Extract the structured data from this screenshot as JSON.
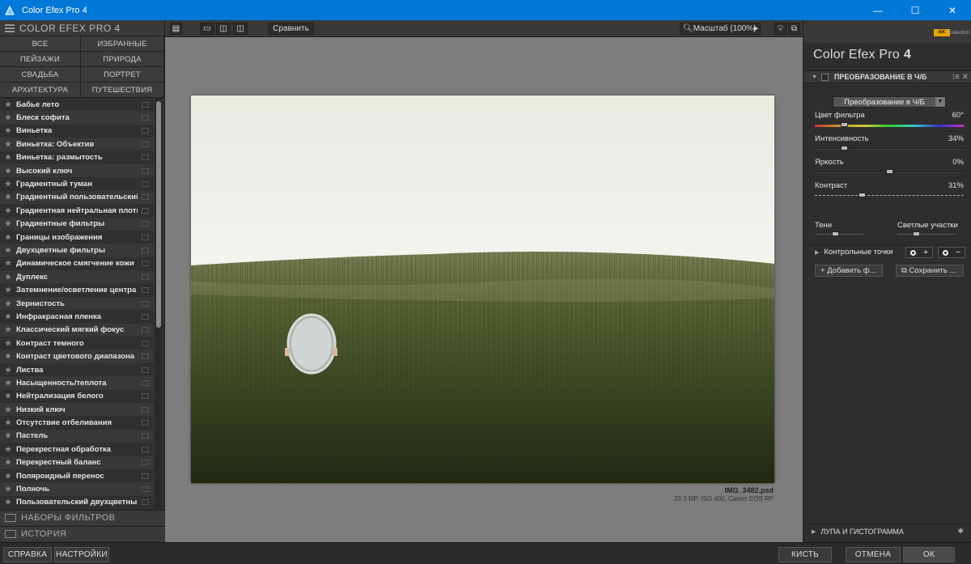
{
  "window": {
    "title": "Color Efex Pro 4"
  },
  "left_panel": {
    "header": "COLOR EFEX PRO 4",
    "categories": [
      "ВСЕ",
      "ИЗБРАННЫЕ",
      "ПЕЙЗАЖИ",
      "ПРИРОДА",
      "СВАДЬБА",
      "ПОРТРЕТ",
      "АРХИТЕКТУРА",
      "ПУТЕШЕСТВИЯ"
    ],
    "filters": [
      "Бабье лето",
      "Блеск софита",
      "Виньетка",
      "Виньетка: Объектив",
      "Виньетка: размытость",
      "Высокий ключ",
      "Градиентный туман",
      "Градиентный пользовательский",
      "Градиентная нейтральная плотн",
      "Градиентные фильтры",
      "Границы изображения",
      "Двухцветные фильтры",
      "Динамическое смягчение кожи",
      "Дуплекс",
      "Затемнение/осветление центра",
      "Зернистость",
      "Инфракрасная пленка",
      "Классический мягкий фокус",
      "Контраст темного",
      "Контраст цветового диапазона",
      "Листва",
      "Насыщенность/теплота",
      "Нейтрализация белого",
      "Низкий ключ",
      "Отсутствие отбеливания",
      "Пастель",
      "Перекрестная обработка",
      "Перекрестный баланс",
      "Поляроидный перенос",
      "Полночь",
      "Пользовательский двухцветный"
    ],
    "presets_label": "НАБОРЫ ФИЛЬТРОВ",
    "history_label": "ИСТОРИЯ"
  },
  "toolbar": {
    "compare_label": "Сравнить",
    "zoom_label": "Масштаб (100%)"
  },
  "image_info": {
    "filename": "IMG_3482.psd",
    "meta": "23.3 MP, ISO 400, Canon EOS RP"
  },
  "right_panel": {
    "logo_text": "Collection",
    "product": "Color Efex Pro",
    "product_num": "4",
    "filter_title": "ПРЕОБРАЗОВАНИЕ В Ч/Б",
    "method_select": "Преобразование в Ч/Б",
    "sliders": [
      {
        "label": "Цвет фильтра",
        "value": "60°",
        "pos": 0.18
      },
      {
        "label": "Интенсивность",
        "value": "34%",
        "pos": 0.18
      },
      {
        "label": "Яркость",
        "value": "0%",
        "pos": 0.5
      },
      {
        "label": "Контраст",
        "value": "31%",
        "pos": 0.31
      }
    ],
    "shadows_label": "Тени",
    "shadows_pos": 0.4,
    "highlights_label": "Светлые участки",
    "highlights_pos": 0.3,
    "control_points_label": "Контрольные точки",
    "add_filter_label": "Добавить ф...",
    "save_preset_label": "Сохранить ...",
    "loupe_label": "ЛУПА И ГИСТОГРАММА"
  },
  "bottom": {
    "help": "СПРАВКА",
    "settings": "НАСТРОЙКИ",
    "brush": "КИСТЬ",
    "cancel": "ОТМЕНА",
    "ok": "ОК"
  }
}
